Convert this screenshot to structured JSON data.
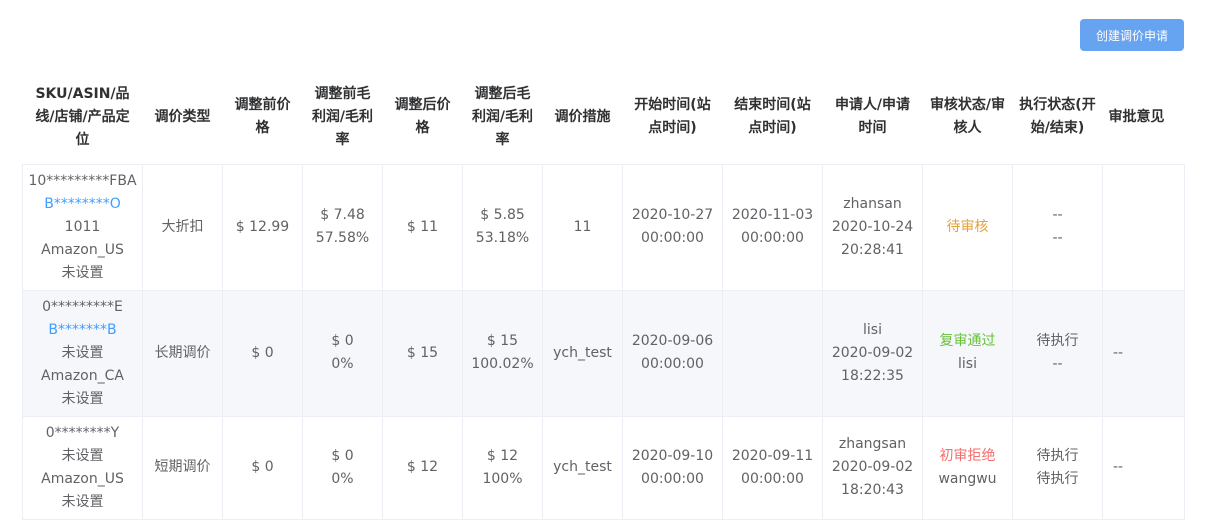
{
  "toolbar": {
    "create_label": "创建调价申请"
  },
  "headers": [
    "SKU/ASIN/品线/店铺/产品定位",
    "调价类型",
    "调整前价格",
    "调整前毛利润/毛利率",
    "调整后价格",
    "调整后毛利润/毛利率",
    "调价措施",
    "开始时间(站点时间)",
    "结束时间(站点时间)",
    "申请人/申请时间",
    "审核状态/审核人",
    "执行状态(开始/结束)",
    "审批意见"
  ],
  "colors": {
    "primary_button": "#66a3f0",
    "link": "#409eff",
    "pending": "#e6a23c",
    "approved": "#67c23a",
    "rejected": "#f56c6c"
  },
  "rows": [
    {
      "sku": "10*********FBA",
      "asin": "B********O",
      "line": "1011",
      "store": "Amazon_US",
      "position": "未设置",
      "type": "大折扣",
      "before_price": "$ 12.99",
      "before_profit": "$ 7.48",
      "before_margin": "57.58%",
      "after_price": "$ 11",
      "after_profit": "$ 5.85",
      "after_margin": "53.18%",
      "measure": "11",
      "start_date": "2020-10-27",
      "start_time": "00:00:00",
      "end_date": "2020-11-03",
      "end_time": "00:00:00",
      "applicant": "zhansan",
      "apply_date": "2020-10-24",
      "apply_time": "20:28:41",
      "review_status": "待审核",
      "reviewer": "",
      "exec_start": "--",
      "exec_end": "--",
      "opinion": ""
    },
    {
      "sku": "0*********E",
      "asin": "B*******B",
      "line": "未设置",
      "store": "Amazon_CA",
      "position": "未设置",
      "type": "长期调价",
      "before_price": "$ 0",
      "before_profit": "$ 0",
      "before_margin": "0%",
      "after_price": "$ 15",
      "after_profit": "$ 15",
      "after_margin": "100.02%",
      "measure": "ych_test",
      "start_date": "2020-09-06",
      "start_time": "00:00:00",
      "end_date": "",
      "end_time": "",
      "applicant": "lisi",
      "apply_date": "2020-09-02",
      "apply_time": "18:22:35",
      "review_status": "复审通过",
      "reviewer": "lisi",
      "exec_start": "待执行",
      "exec_end": "--",
      "opinion": "--"
    },
    {
      "sku": "0********Y",
      "asin": "",
      "line": "未设置",
      "store": "Amazon_US",
      "position": "未设置",
      "type": "短期调价",
      "before_price": "$ 0",
      "before_profit": "$ 0",
      "before_margin": "0%",
      "after_price": "$ 12",
      "after_profit": "$ 12",
      "after_margin": "100%",
      "measure": "ych_test",
      "start_date": "2020-09-10",
      "start_time": "00:00:00",
      "end_date": "2020-09-11",
      "end_time": "00:00:00",
      "applicant": "zhangsan",
      "apply_date": "2020-09-02",
      "apply_time": "18:20:43",
      "review_status": "初审拒绝",
      "reviewer": "wangwu",
      "exec_start": "待执行",
      "exec_end": "待执行",
      "opinion": "--"
    }
  ]
}
